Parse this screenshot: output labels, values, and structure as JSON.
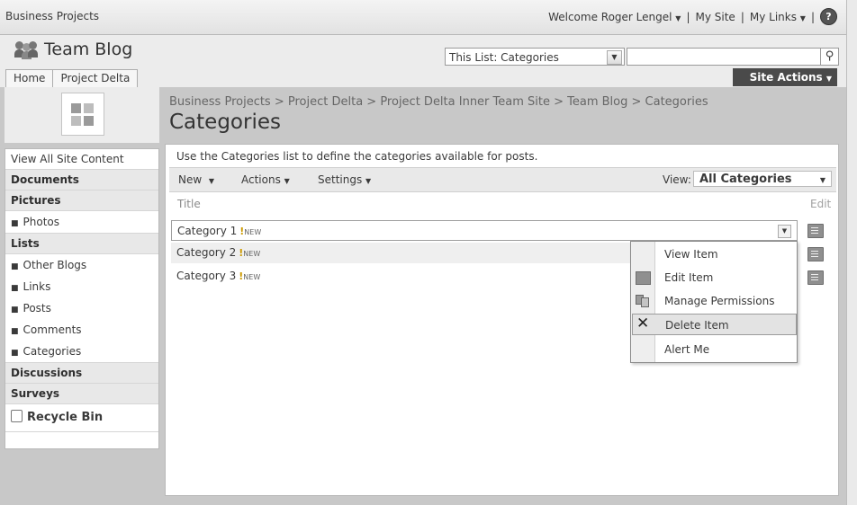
{
  "top_bar": {
    "site_name": "Business Projects",
    "welcome": "Welcome Roger Lengel",
    "my_site": "My Site",
    "my_links": "My Links",
    "separator": "|"
  },
  "header": {
    "title": "Team Blog",
    "search_scope": "This List: Categories",
    "search_value": "",
    "tabs": [
      "Home",
      "Project Delta"
    ],
    "site_actions": "Site Actions"
  },
  "nav": {
    "view_all": "View All Site Content",
    "documents": "Documents",
    "pictures": "Pictures",
    "pictures_items": [
      "Photos"
    ],
    "lists": "Lists",
    "lists_items": [
      "Other Blogs",
      "Links",
      "Posts",
      "Comments",
      "Categories"
    ],
    "discussions": "Discussions",
    "surveys": "Surveys",
    "recycle_bin": "Recycle Bin"
  },
  "page": {
    "breadcrumb": "Business Projects > Project Delta > Project Delta Inner Team Site > Team Blog > Categories",
    "title": "Categories",
    "description": "Use the Categories list to define the categories available for posts."
  },
  "toolbar": {
    "new": "New",
    "actions": "Actions",
    "settings": "Settings",
    "view_label": "View:",
    "view_value": "All Categories"
  },
  "list": {
    "col_title": "Title",
    "col_edit": "Edit",
    "new_badge": "NEW",
    "rows": [
      "Category 1",
      "Category 2",
      "Category 3"
    ]
  },
  "context_menu": {
    "items": [
      "View Item",
      "Edit Item",
      "Manage Permissions",
      "Delete Item",
      "Alert Me"
    ]
  },
  "colors": {
    "site_actions_bg": "#4a4a4a",
    "menu_highlight": "#e3e3e3",
    "new_badge_accent": "#cc9a00"
  }
}
